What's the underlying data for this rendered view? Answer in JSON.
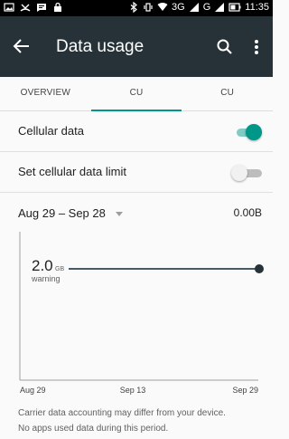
{
  "status_bar": {
    "time": "11:35",
    "network_1": "3G",
    "network_2": "G"
  },
  "app_bar": {
    "title": "Data usage"
  },
  "tabs": [
    {
      "label": "OVERVIEW",
      "active": false
    },
    {
      "label": "CU",
      "active": true
    },
    {
      "label": "CU",
      "active": false
    }
  ],
  "settings": {
    "cellular_data": {
      "label": "Cellular data",
      "enabled": true
    },
    "data_limit": {
      "label": "Set cellular data limit",
      "enabled": false
    }
  },
  "period": {
    "label": "Aug 29 – Sep 28",
    "usage": "0.00B"
  },
  "chart": {
    "warning_value": "2.0",
    "warning_unit": "GB",
    "warning_label": "warning",
    "x_labels": [
      "Aug 29",
      "Sep 13",
      "Sep 29"
    ]
  },
  "chart_data": {
    "type": "line",
    "x": [
      "Aug 29",
      "Sep 13",
      "Sep 29"
    ],
    "annotations": [
      {
        "label": "warning",
        "value": 2.0,
        "unit": "GB"
      }
    ]
  },
  "footer": {
    "line1": "Carrier data accounting may differ from your device.",
    "line2": "No apps used data during this period."
  },
  "colors": {
    "app_bar": "#263238",
    "accent": "#009688",
    "accent_track": "#80cbc4"
  }
}
